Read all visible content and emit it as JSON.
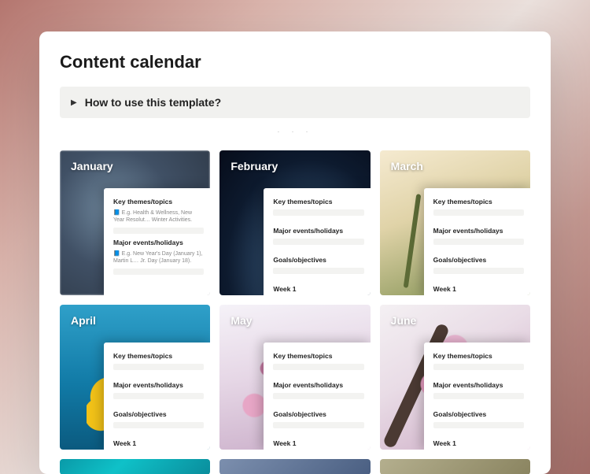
{
  "page_title": "Content calendar",
  "callout": {
    "text": "How to use this template?"
  },
  "divider_dots": "·  ·  ·",
  "sections": {
    "key_themes": "Key themes/topics",
    "events": "Major events/holidays",
    "goals": "Goals/objectives",
    "week1": "Week 1"
  },
  "months": [
    {
      "name": "January",
      "bg": "bg-jan",
      "themes_note": "📘 E.g. Health & Wellness, New Year Resolut… Winter Activities.",
      "events_note": "📘 E.g. New Year's Day (January 1), Martin L… Jr. Day (January 18)."
    },
    {
      "name": "February",
      "bg": "bg-feb"
    },
    {
      "name": "March",
      "bg": "bg-mar"
    },
    {
      "name": "April",
      "bg": "bg-apr"
    },
    {
      "name": "May",
      "bg": "bg-may"
    },
    {
      "name": "June",
      "bg": "bg-jun"
    }
  ]
}
